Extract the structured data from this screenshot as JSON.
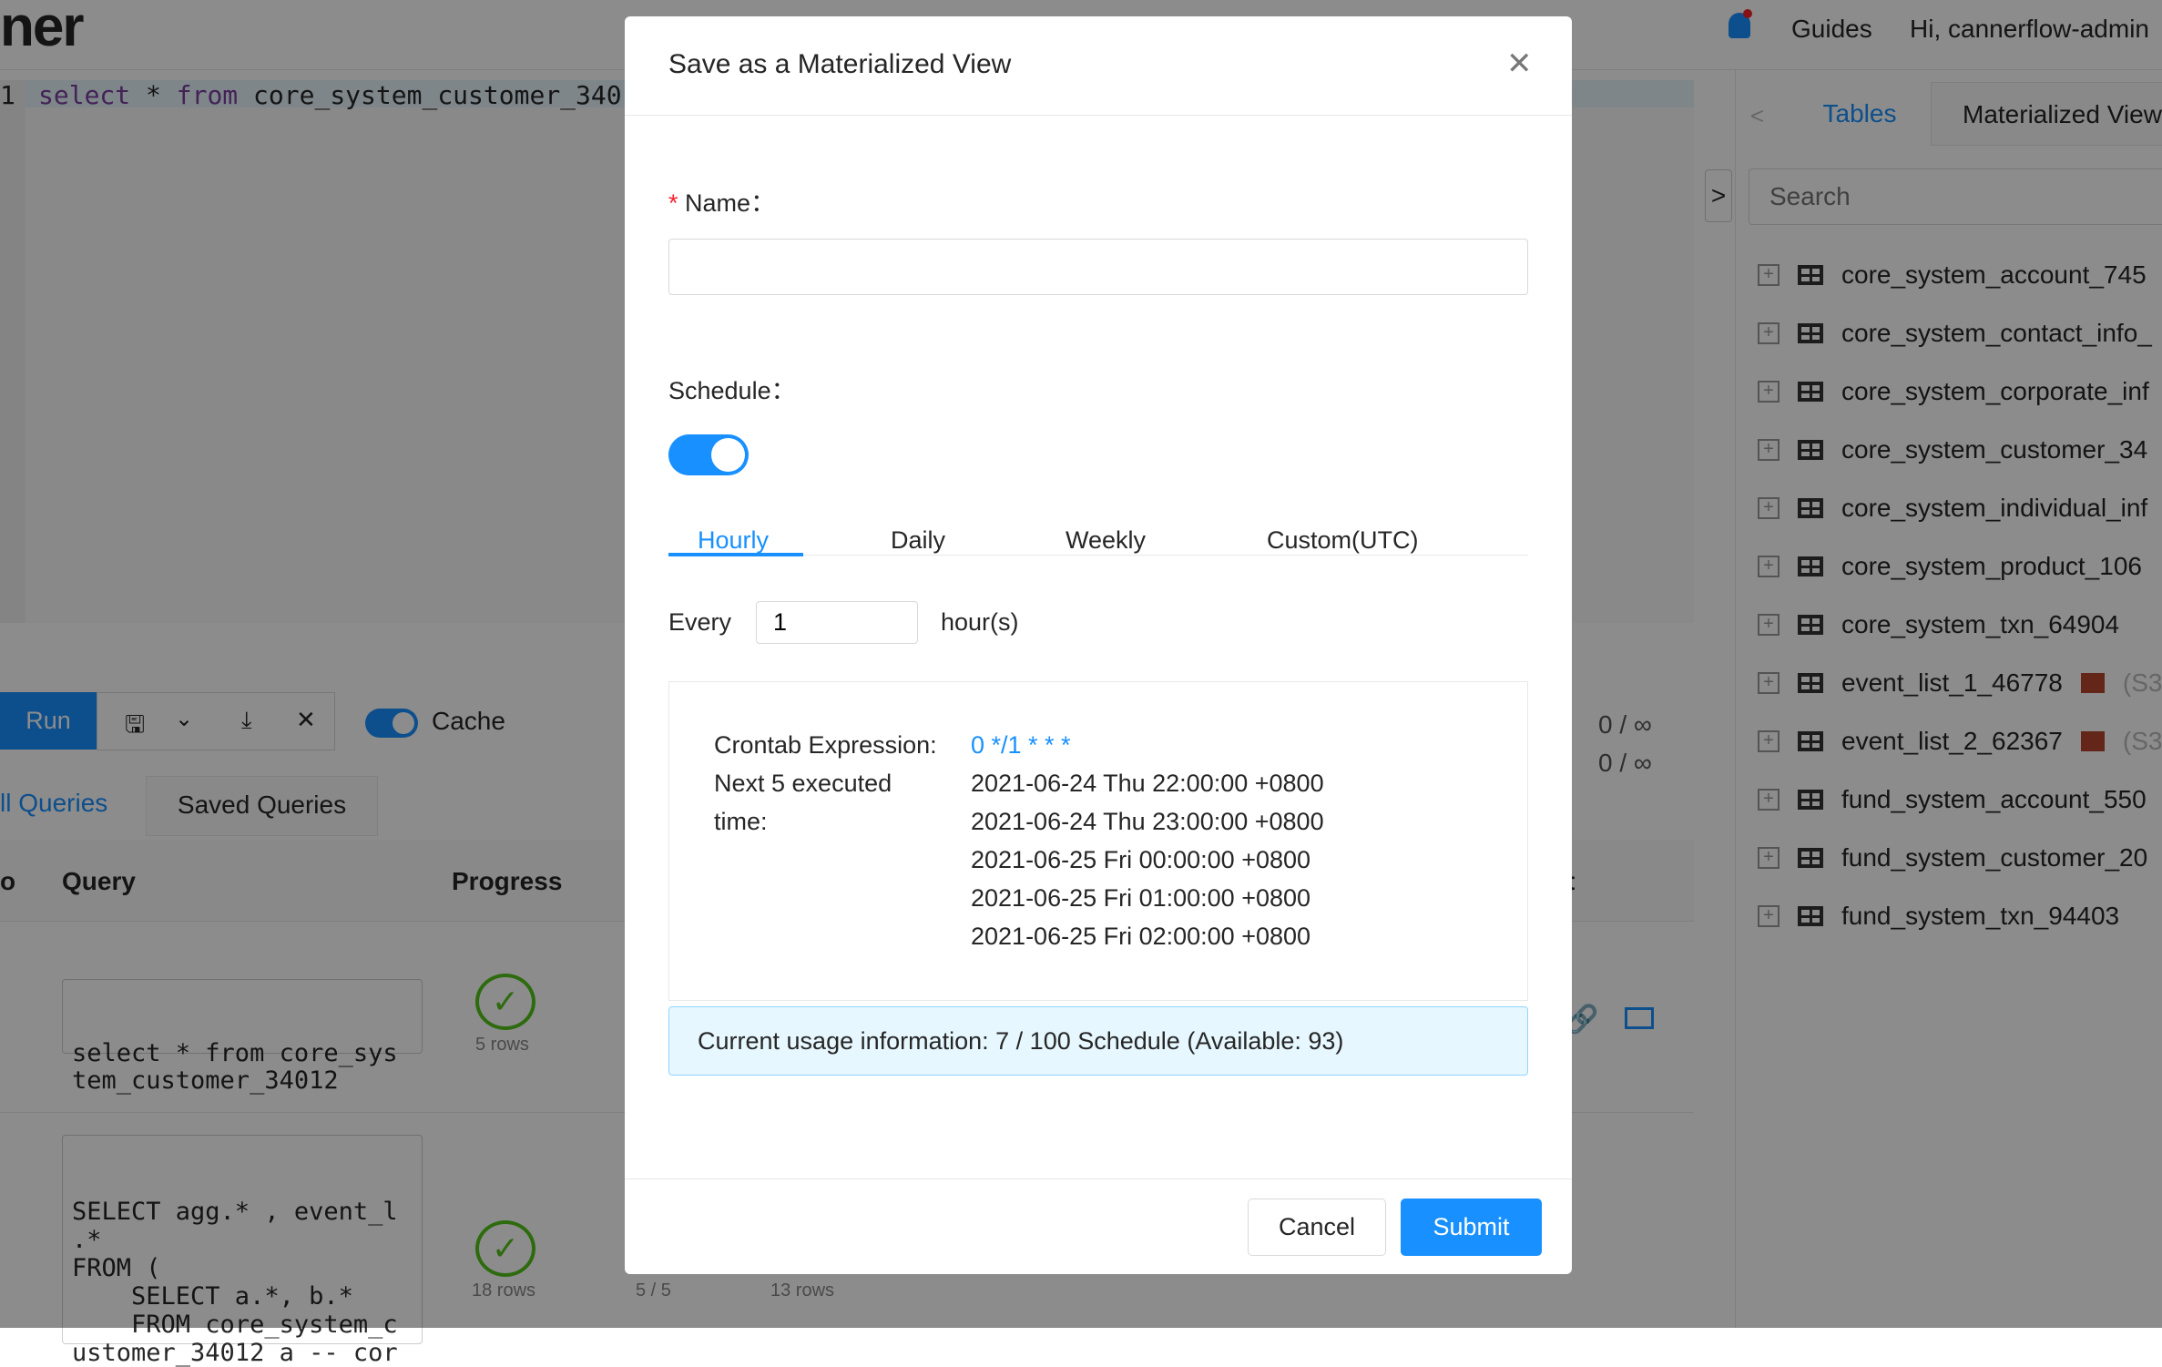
{
  "header": {
    "logo": "ner",
    "guides": "Guides",
    "greeting": "Hi, cannerflow-admin"
  },
  "editor": {
    "line_number": "1",
    "query_kw1": "select",
    "query_star": "*",
    "query_kw2": "from",
    "query_rest": "core_system_customer_340"
  },
  "toolbar": {
    "run_label": "Run",
    "cache_label": "Cache",
    "cache_on": true
  },
  "usage_side": [
    "0 / ∞",
    "0 / ∞"
  ],
  "query_tabs": [
    "ll Queries",
    "Saved Queries"
  ],
  "table": {
    "headers": [
      "o",
      "Query",
      "Progress",
      "t"
    ],
    "rows": [
      {
        "query_lines": [
          "select * from core_sys",
          "tem_customer_34012"
        ],
        "rows_label": "5 rows"
      },
      {
        "query_lines": [
          "SELECT agg.* , event_l",
          ".*",
          "FROM (",
          "    SELECT a.*, b.*",
          "    FROM core_system_c",
          "ustomer_34012 a -- cor"
        ],
        "rows_label": "18 rows",
        "extra": [
          "5 / 5",
          "13 rows"
        ]
      }
    ]
  },
  "sidebar": {
    "tabs": [
      "Tables",
      "Materialized View"
    ],
    "search_placeholder": "Search",
    "items": [
      "core_system_account_745",
      "core_system_contact_info_",
      "core_system_corporate_inf",
      "core_system_customer_34",
      "core_system_individual_inf",
      "core_system_product_106",
      "core_system_txn_64904",
      "event_list_1_46778",
      "event_list_2_62367",
      "fund_system_account_550",
      "fund_system_customer_20",
      "fund_system_txn_94403"
    ],
    "item_suffix": "(S3"
  },
  "modal": {
    "title": "Save as a Materialized View",
    "name_label": "Name",
    "required_mark": "*",
    "name_value": "",
    "schedule_label": "Schedule",
    "schedule_enabled": true,
    "tabs": [
      "Hourly",
      "Daily",
      "Weekly",
      "Custom(UTC)"
    ],
    "active_tab": "Hourly",
    "every_label": "Every",
    "every_value": "1",
    "every_unit": "hour(s)",
    "crontab_label": "Crontab Expression:",
    "crontab_value": "0 */1 * * *",
    "next_label_1": "Next 5 executed",
    "next_label_2": "time:",
    "next_times": [
      "2021-06-24 Thu 22:00:00 +0800",
      "2021-06-24 Thu 23:00:00 +0800",
      "2021-06-25 Fri 00:00:00 +0800",
      "2021-06-25 Fri 01:00:00 +0800",
      "2021-06-25 Fri 02:00:00 +0800"
    ],
    "usage_info": "Current usage information: 7 / 100 Schedule (Available: 93)",
    "cancel": "Cancel",
    "submit": "Submit"
  },
  "colors": {
    "primary": "#1890ff",
    "success": "#52c41a"
  }
}
